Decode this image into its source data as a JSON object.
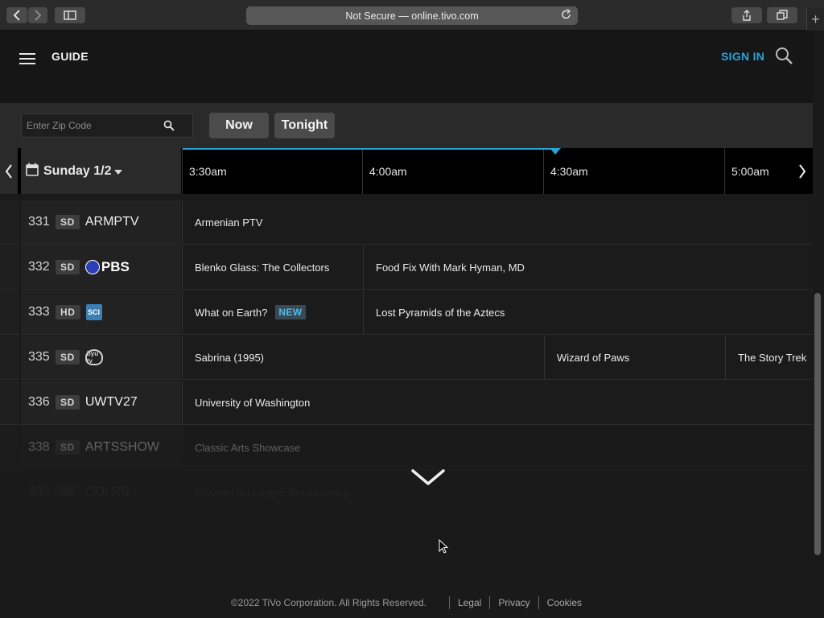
{
  "browser": {
    "url_text": "Not Secure — online.tivo.com",
    "back_icon": "‹",
    "forward_icon": "›"
  },
  "header": {
    "title": "GUIDE",
    "sign_in": "SIGN IN"
  },
  "filters": {
    "zip_placeholder": "Enter Zip Code",
    "now_label": "Now",
    "tonight_label": "Tonight"
  },
  "timeline": {
    "date": "Sunday 1/2",
    "slots": [
      "3:30am",
      "4:00am",
      "4:30am",
      "5:00am"
    ]
  },
  "channels": [
    {
      "number": "331",
      "quality": "SD",
      "callsign": "ARMPTV",
      "programs": [
        {
          "title": "Armenian PTV"
        }
      ]
    },
    {
      "number": "332",
      "quality": "SD",
      "callsign": "PBS",
      "logo": "pbs-logo",
      "programs": [
        {
          "title": "Blenko Glass: The Collectors"
        },
        {
          "title": "Food Fix With Mark Hyman, MD"
        }
      ]
    },
    {
      "number": "333",
      "quality": "HD",
      "callsign": "SCI",
      "logo": "sci-logo",
      "programs": [
        {
          "title": "What on Earth?",
          "badge": "NEW"
        },
        {
          "title": "Lost Pyramids of the Aztecs"
        }
      ]
    },
    {
      "number": "335",
      "quality": "SD",
      "callsign": "byu tv",
      "logo": "byu-logo",
      "programs": [
        {
          "title": "Sabrina (1995)"
        },
        {
          "title": "Wizard of Paws"
        },
        {
          "title": "The Story Trek"
        }
      ]
    },
    {
      "number": "336",
      "quality": "SD",
      "callsign": "UWTV27",
      "programs": [
        {
          "title": "University of Washington"
        }
      ]
    },
    {
      "number": "338",
      "quality": "SD",
      "callsign": "ARTSSHOW",
      "programs": [
        {
          "title": "Classic Arts Showcase"
        }
      ]
    },
    {
      "number": "339",
      "quality": "SD",
      "callsign": "COLRS",
      "programs": [
        {
          "title": "Channel No Longer Broadcasting"
        }
      ]
    }
  ],
  "footer": {
    "copyright": "©2022 TiVo Corporation. All Rights Reserved.",
    "legal": "Legal",
    "privacy": "Privacy",
    "cookies": "Cookies"
  },
  "colors": {
    "accent": "#2aa3d8",
    "background": "#1a1a1a"
  }
}
